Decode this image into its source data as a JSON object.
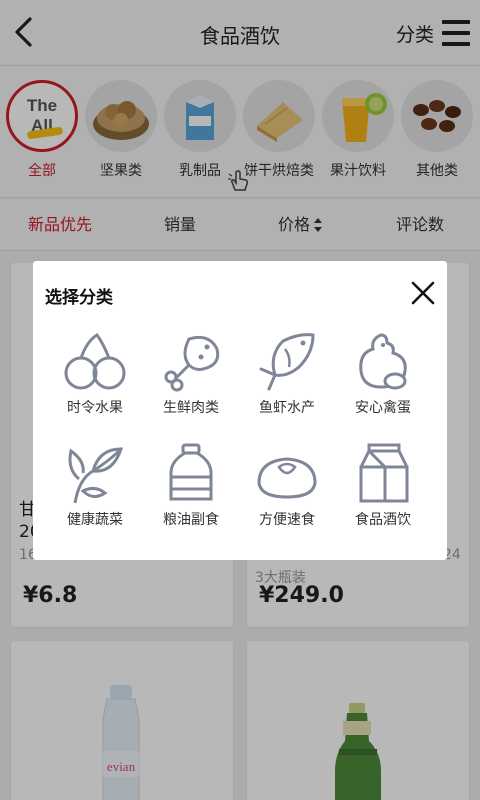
{
  "header": {
    "title": "食品酒饮",
    "category_label": "分类"
  },
  "categories": [
    {
      "label": "全部",
      "thumb_line1": "The",
      "thumb_line2": "All",
      "active": true
    },
    {
      "label": "坚果类",
      "icon": "nuts-photo"
    },
    {
      "label": "乳制品",
      "icon": "milk-carton-photo"
    },
    {
      "label": "饼干烘焙类",
      "icon": "pastry-photo"
    },
    {
      "label": "果汁饮料",
      "icon": "juice-photo"
    },
    {
      "label": "其他类",
      "icon": "coffee-beans-photo"
    }
  ],
  "sort": {
    "items": [
      {
        "label": "新品优先",
        "active": true
      },
      {
        "label": "销量"
      },
      {
        "label": "价格",
        "has_sort_arrows": true
      },
      {
        "label": "评论数"
      }
    ]
  },
  "products": [
    {
      "name_line1": "甘",
      "name_line2": "20",
      "sub": "16",
      "price": "¥6.8"
    },
    {
      "sub_right": "24",
      "sub": "3大瓶装",
      "price": "¥249.0"
    },
    {
      "image": "evian-bottle",
      "bottle_text": "evian"
    },
    {
      "image": "perrier-bottle"
    }
  ],
  "modal": {
    "title": "选择分类",
    "items": [
      {
        "label": "时令水果",
        "icon": "cherry-icon"
      },
      {
        "label": "生鲜肉类",
        "icon": "drumstick-icon"
      },
      {
        "label": "鱼虾水产",
        "icon": "fish-icon"
      },
      {
        "label": "安心禽蛋",
        "icon": "chicken-egg-icon"
      },
      {
        "label": "健康蔬菜",
        "icon": "leaves-icon"
      },
      {
        "label": "粮油副食",
        "icon": "oil-bottle-icon"
      },
      {
        "label": "方便速食",
        "icon": "bun-icon"
      },
      {
        "label": "食品酒饮",
        "icon": "milk-box-icon"
      }
    ]
  },
  "colors": {
    "accent": "#d21e2b",
    "icon_stroke": "#7f8697"
  }
}
